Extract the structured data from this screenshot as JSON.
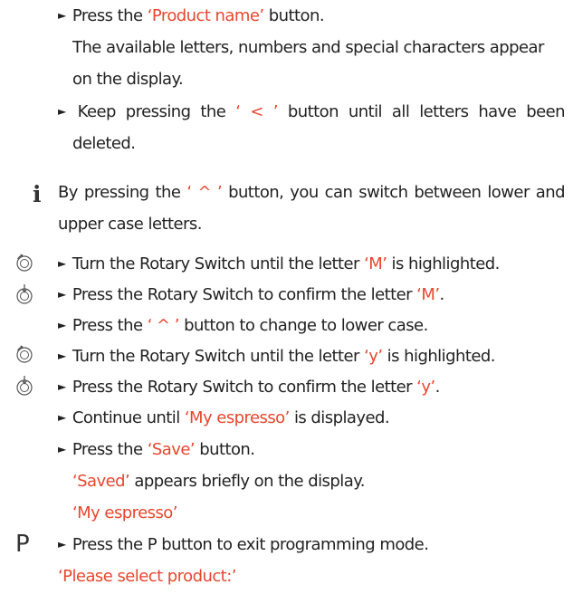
{
  "bullet": "►",
  "steps": [
    {
      "a": "Press the ",
      "b": "‘Product name’",
      "c": " button."
    },
    {
      "a": "The available letters, numbers and special characters appear"
    },
    {
      "a": "on the display."
    },
    {
      "a": "Keep pressing the ",
      "b": "‘ < ’",
      "c": " button until all letters have been"
    },
    {
      "a": "deleted."
    }
  ],
  "info": {
    "icon": "info-icon",
    "l1a": "By pressing the ",
    "l1b": "‘ ^ ’",
    "l1c": " button, you can switch between lower and",
    "l2": "upper case letters."
  },
  "rotary": [
    {
      "icon": "rotary-turn-icon",
      "a": "Turn the Rotary Switch until the letter ",
      "b": "‘M’",
      "c": " is highlighted."
    },
    {
      "icon": "rotary-press-icon",
      "a": "Press the Rotary Switch to confirm the letter ",
      "b": "‘M’",
      "c": "."
    },
    {
      "a": "Press the ",
      "b": "‘ ^ ’",
      "c": " button to change to lower case."
    },
    {
      "icon": "rotary-turn-icon",
      "a": "Turn the Rotary Switch until the letter ",
      "b": "‘y’",
      "c": " is highlighted."
    },
    {
      "icon": "rotary-press-icon",
      "a": "Press the Rotary Switch to confirm the letter ",
      "b": "‘y’",
      "c": "."
    },
    {
      "a": "Continue until ",
      "b": "‘My espresso’",
      "c": " is displayed."
    },
    {
      "a": "Press the ",
      "b": "‘Save’",
      "c": " button."
    }
  ],
  "saved": {
    "a": "‘Saved’",
    "b": " appears briefly on the display."
  },
  "display_name": "‘My espresso’",
  "p_step": {
    "key": "P",
    "text": "Press the P button to exit programming mode."
  },
  "final_display": "‘Please select product:’",
  "colors": {
    "highlight": "#e8462e",
    "text": "#222222"
  }
}
